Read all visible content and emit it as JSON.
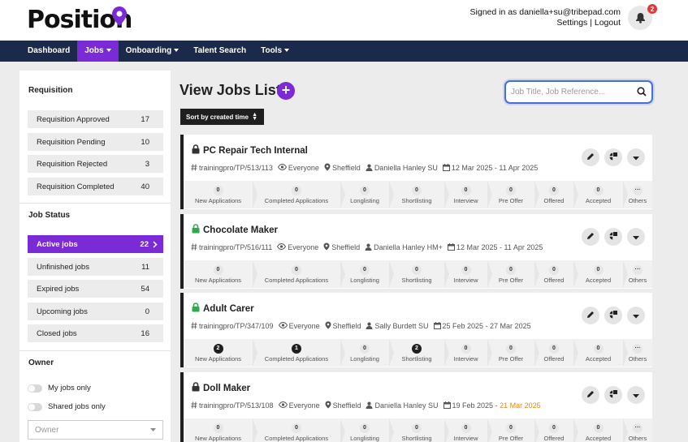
{
  "header": {
    "logo_text": "Position",
    "signed_in": "Signed in as daniella+su@tribepad.com",
    "settings_label": "Settings",
    "separator": "|",
    "logout_label": "Logout",
    "notification_count": "2"
  },
  "nav": {
    "items": [
      {
        "label": "Dashboard"
      },
      {
        "label": "Jobs"
      },
      {
        "label": "Onboarding"
      },
      {
        "label": "Talent Search"
      },
      {
        "label": "Tools"
      }
    ]
  },
  "sidebar": {
    "requisition_title": "Requisition",
    "requisition": [
      {
        "label": "Requisition Approved",
        "count": "17"
      },
      {
        "label": "Requisition Pending",
        "count": "10"
      },
      {
        "label": "Requisition Rejected",
        "count": "3"
      },
      {
        "label": "Requisition Completed",
        "count": "40"
      }
    ],
    "job_status_title": "Job Status",
    "job_status": [
      {
        "label": "Active jobs",
        "count": "22"
      },
      {
        "label": "Unfinished jobs",
        "count": "11"
      },
      {
        "label": "Expired jobs",
        "count": "54"
      },
      {
        "label": "Upcoming jobs",
        "count": "0"
      },
      {
        "label": "Closed jobs",
        "count": "16"
      }
    ],
    "owner_title": "Owner",
    "my_jobs_only": "My jobs only",
    "shared_jobs_only": "Shared jobs only",
    "owner_select": "Owner"
  },
  "main": {
    "title": "View Jobs List",
    "add_symbol": "+",
    "search_placeholder": "Job Title, Job Reference...",
    "sort_label": "Sort by created time"
  },
  "stage_labels": [
    "New Applications",
    "Completed Applications",
    "Longlisting",
    "Shortlisting",
    "Interview",
    "Pre Offer",
    "Offered",
    "Accepted",
    "Others"
  ],
  "jobs": [
    {
      "title": "PC Repair Tech Internal",
      "locked": "dark",
      "reference": "trainingpro/TP/513/113",
      "visibility": "Everyone",
      "location": "Sheffield",
      "owner": "Daniella Hanley SU",
      "date_start": "12 Mar 2025 - ",
      "date_end": "11 Apr 2025",
      "date_end_orange": false,
      "counts": [
        "0",
        "0",
        "0",
        "0",
        "0",
        "0",
        "0",
        "0",
        "···"
      ],
      "filled": [
        false,
        false,
        false,
        false,
        false,
        false,
        false,
        false,
        false
      ]
    },
    {
      "title": "Chocolate Maker",
      "locked": "green",
      "reference": "trainingpro/TP/516/111",
      "visibility": "Everyone",
      "location": "Sheffield",
      "owner": "Daniella Hanley HM+",
      "date_start": "12 Mar 2025 - ",
      "date_end": "11 Apr 2025",
      "date_end_orange": false,
      "counts": [
        "0",
        "0",
        "0",
        "0",
        "0",
        "0",
        "0",
        "0",
        "···"
      ],
      "filled": [
        false,
        false,
        false,
        false,
        false,
        false,
        false,
        false,
        false
      ]
    },
    {
      "title": "Adult Carer",
      "locked": "green",
      "reference": "trainingpro/TP/347/109",
      "visibility": "Everyone",
      "location": "Sheffield",
      "owner": "Sally Burdett SU",
      "date_start": "25 Feb 2025 - ",
      "date_end": "27 Mar 2025",
      "date_end_orange": false,
      "counts": [
        "2",
        "1",
        "0",
        "2",
        "0",
        "0",
        "0",
        "0",
        "···"
      ],
      "filled": [
        true,
        true,
        false,
        true,
        false,
        false,
        false,
        false,
        false
      ]
    },
    {
      "title": "Doll Maker",
      "locked": "dark",
      "reference": "trainingpro/TP/513/108",
      "visibility": "Everyone",
      "location": "Sheffield",
      "owner": "Daniella Hanley SU",
      "date_start": "19 Feb 2025 - ",
      "date_end": "21 Mar 2025",
      "date_end_orange": true,
      "counts": [
        "0",
        "0",
        "0",
        "0",
        "0",
        "0",
        "0",
        "0",
        "···"
      ],
      "filled": [
        false,
        false,
        false,
        false,
        false,
        false,
        false,
        false,
        false
      ]
    }
  ],
  "colors": {
    "accent": "#7a2bd6",
    "nav_bg": "#1b2a4a",
    "lock_green": "#2fa84f",
    "lock_dark": "#333333",
    "date_warning": "#e08a1e"
  }
}
